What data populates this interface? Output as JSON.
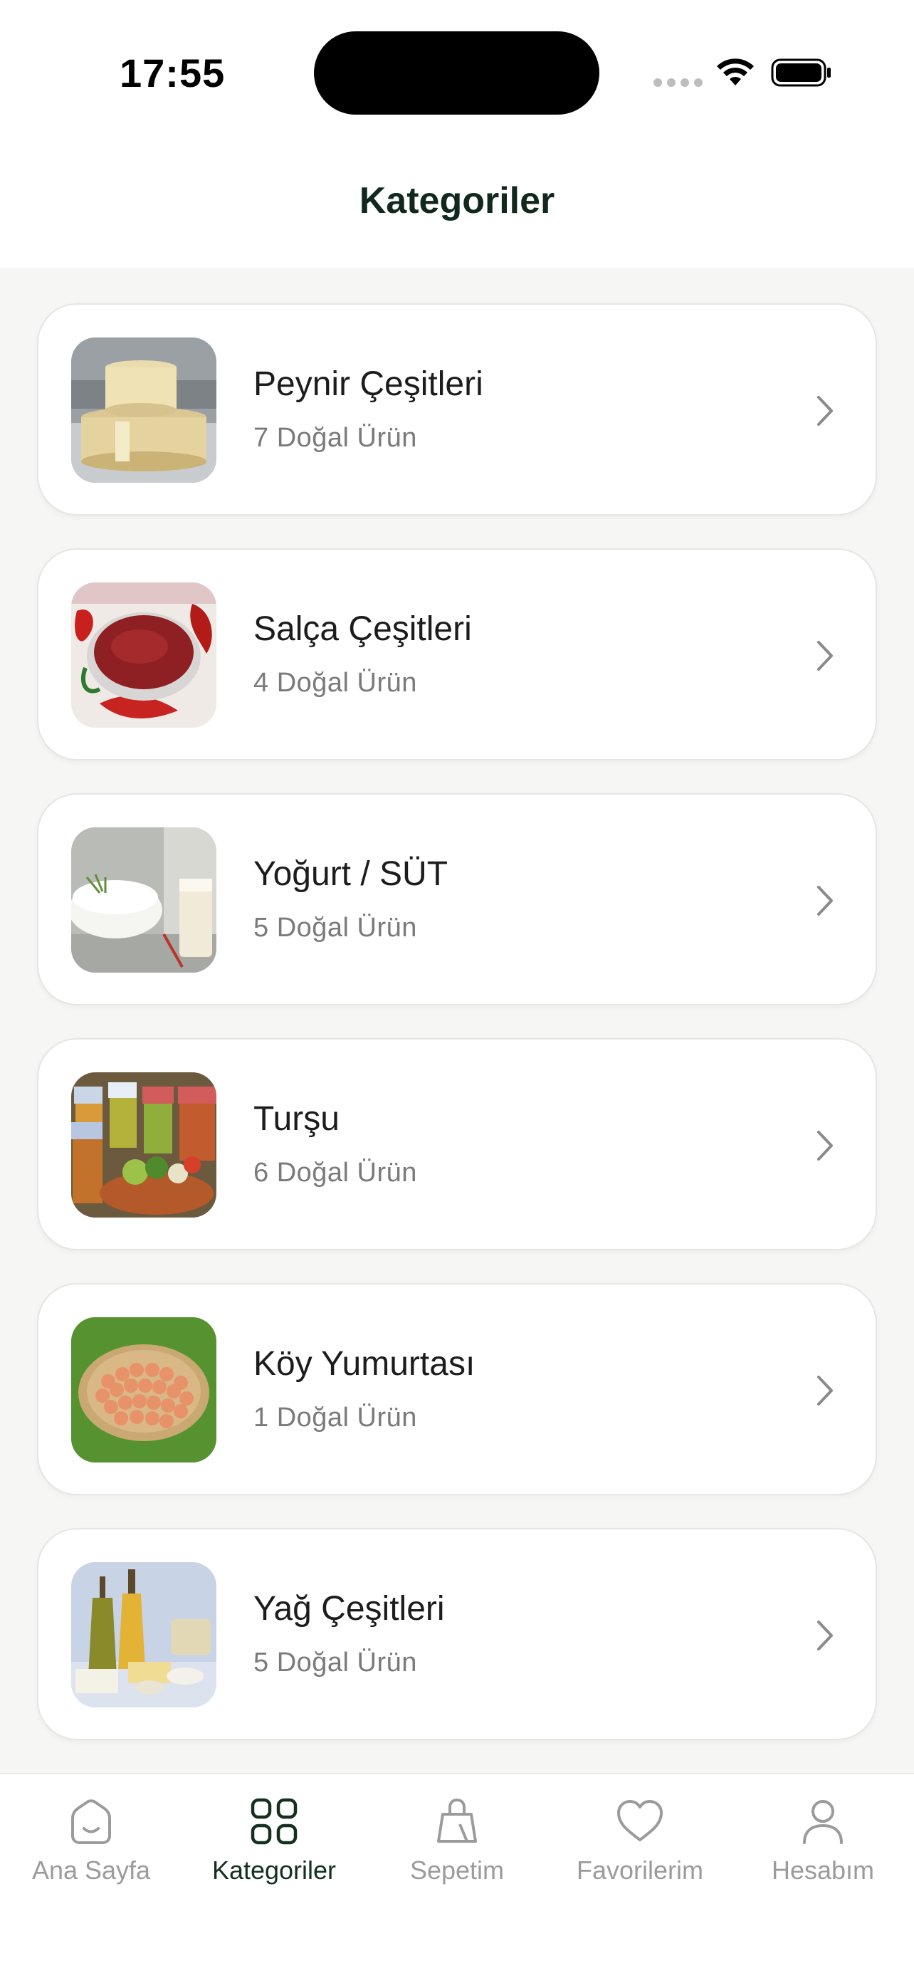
{
  "status_bar": {
    "time": "17:55"
  },
  "header": {
    "title": "Kategoriler"
  },
  "categories": [
    {
      "name": "Peynir Çeşitleri",
      "count": "7 Doğal Ürün",
      "image_icon": "cheese-image"
    },
    {
      "name": "Salça Çeşitleri",
      "count": "4 Doğal Ürün",
      "image_icon": "tomato-paste-image"
    },
    {
      "name": "Yoğurt / SÜT",
      "count": "5 Doğal Ürün",
      "image_icon": "yogurt-milk-image"
    },
    {
      "name": "Turşu",
      "count": "6 Doğal Ürün",
      "image_icon": "pickle-jars-image"
    },
    {
      "name": "Köy Yumurtası",
      "count": "1 Doğal Ürün",
      "image_icon": "eggs-basket-image"
    },
    {
      "name": "Yağ Çeşitleri",
      "count": "5 Doğal Ürün",
      "image_icon": "oils-butter-image"
    }
  ],
  "tab_bar": {
    "active": "Kategoriler",
    "active_color": "#13301f",
    "inactive_color": "#9b9b9b",
    "tabs": [
      {
        "label": "Ana Sayfa",
        "icon": "home-icon"
      },
      {
        "label": "Kategoriler",
        "icon": "grid-icon"
      },
      {
        "label": "Sepetim",
        "icon": "shopping-bag-icon"
      },
      {
        "label": "Favorilerim",
        "icon": "heart-icon"
      },
      {
        "label": "Hesabım",
        "icon": "user-icon"
      }
    ]
  }
}
